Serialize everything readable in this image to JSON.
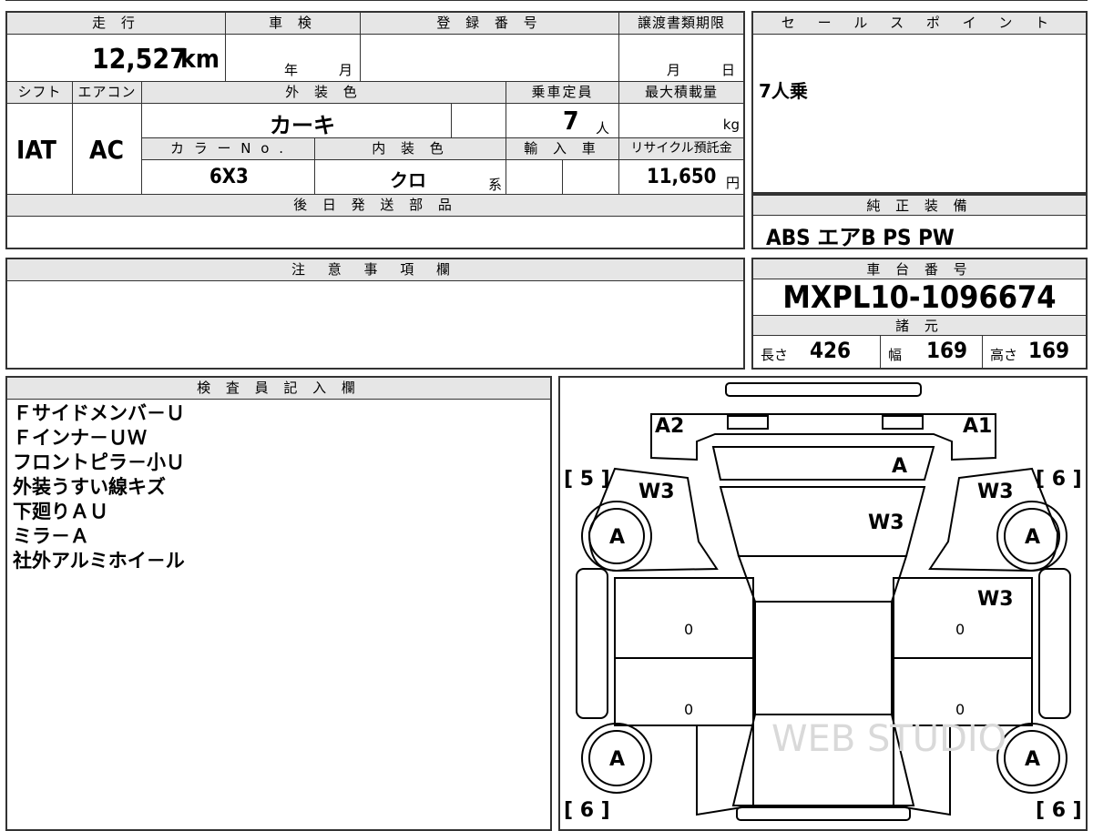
{
  "sheet": {
    "mileage_label": "走 行",
    "mileage_value": "12,527",
    "mileage_unit": "km",
    "inspection_label": "車 検",
    "inspection_year": "年",
    "inspection_month": "月",
    "registration_label": "登 録 番 号",
    "transfer_label": "譲渡書類期限",
    "transfer_month": "月",
    "transfer_day": "日",
    "shift_label": "シフト",
    "shift_value": "IAT",
    "ac_label": "エアコン",
    "ac_value": "AC",
    "ext_color_label": "外 装 色",
    "ext_color_value": "カーキ",
    "capacity_label": "乗車定員",
    "capacity_value": "7",
    "capacity_unit": "人",
    "load_label": "最大積載量",
    "load_unit": "kg",
    "color_no_label": "カ ラ ー N o .",
    "color_no_value": "6X3",
    "int_color_label": "内 装 色",
    "int_color_value": "クロ",
    "int_color_suffix": "系",
    "import_label": "輸 入 車",
    "recycle_label": "リサイクル預託金",
    "recycle_value": "11,650",
    "recycle_unit": "円",
    "later_parts_label": "後 日 発 送 部 品",
    "notes_label": "注 意 事 項 欄",
    "sales_label": "セ ー ル ス ポ イ ン ト",
    "sales_value": "7人乗",
    "equip_label": "純 正 装 備",
    "equip_value": "ABS エアB PS PW",
    "chassis_label": "車 台 番 号",
    "chassis_value": "MXPL10-1096674",
    "spec_label": "諸 元",
    "length_label": "長さ",
    "length_value": "426",
    "width_label": "幅",
    "width_value": "169",
    "height_label": "高さ",
    "height_value": "169",
    "inspector_label": "検 査 員 記 入 欄",
    "inspector_lines": [
      "Ｆサイドメンバ－Ｕ",
      "Ｆインナ－ＵＷ",
      "フロントピラ－小Ｕ",
      "外装うすい線キズ",
      "下廻りＡＵ",
      "ミラ－Ａ",
      "社外アルミホイ－ル"
    ]
  },
  "diagram": {
    "a2": "A2",
    "a1": "A1",
    "left_front_bracket": "[ 5 ]",
    "right_front_bracket": "[ 6 ]",
    "left_rear_bracket": "[ 6 ]",
    "right_rear_bracket": "[ 6 ]",
    "w3_left_front": "W3",
    "w3_right_front": "W3",
    "w3_hood": "W3",
    "w3_right_door": "W3",
    "a_windshield": "A",
    "wheel_lf": "A",
    "wheel_rf": "A",
    "wheel_lr": "A",
    "wheel_rr": "A",
    "zero_l1": "0",
    "zero_l2": "0",
    "zero_r1": "0",
    "zero_r2": "0",
    "watermark": "WEB STUDIO"
  }
}
